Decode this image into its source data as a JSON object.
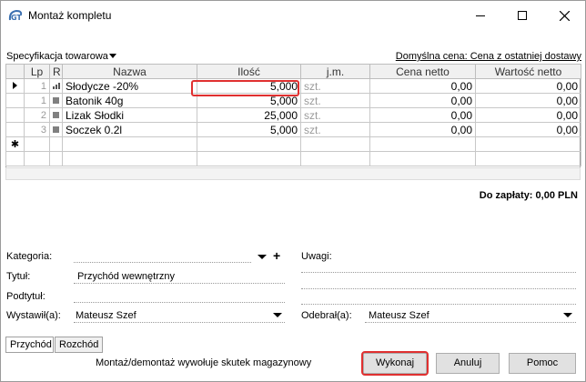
{
  "window": {
    "title": "Montaż kompletu"
  },
  "spec": {
    "label": "Specyfikacja towarowa",
    "price_link": "Domyślna cena: Cena z ostatniej dostawy"
  },
  "table": {
    "headers": [
      "Lp",
      "R",
      "Nazwa",
      "Ilość",
      "j.m.",
      "Cena netto",
      "Wartość netto"
    ],
    "rows": [
      {
        "lp": "1",
        "name": "Słodycze -20%",
        "qty": "5,000",
        "unit": "szt.",
        "price": "0,00",
        "value": "0,00"
      },
      {
        "lp": "1",
        "name": "Batonik 40g",
        "qty": "5,000",
        "unit": "szt.",
        "price": "0,00",
        "value": "0,00"
      },
      {
        "lp": "2",
        "name": "Lizak Słodki",
        "qty": "25,000",
        "unit": "szt.",
        "price": "0,00",
        "value": "0,00"
      },
      {
        "lp": "3",
        "name": "Soczek 0.2l",
        "qty": "5,000",
        "unit": "szt.",
        "price": "0,00",
        "value": "0,00"
      }
    ],
    "new_row_marker": "✱"
  },
  "total": "Do zapłaty: 0,00 PLN",
  "form": {
    "kategoria_label": "Kategoria:",
    "uwagi_label": "Uwagi:",
    "tytul_label": "Tytuł:",
    "tytul_value": "Przychód wewnętrzny",
    "podtytul_label": "Podtytuł:",
    "wystawil_label": "Wystawił(a):",
    "wystawil_value": "Mateusz Szef",
    "odebral_label": "Odebrał(a):",
    "odebral_value": "Mateusz Szef"
  },
  "tabs": [
    "Przychód",
    "Rozchód"
  ],
  "footer": {
    "note": "Montaż/demontaż wywołuje skutek magazynowy",
    "execute": "Wykonaj",
    "cancel": "Anuluj",
    "help": "Pomoc"
  },
  "colors": {
    "highlight": "#e03030",
    "logo": "#3a6fb0"
  }
}
